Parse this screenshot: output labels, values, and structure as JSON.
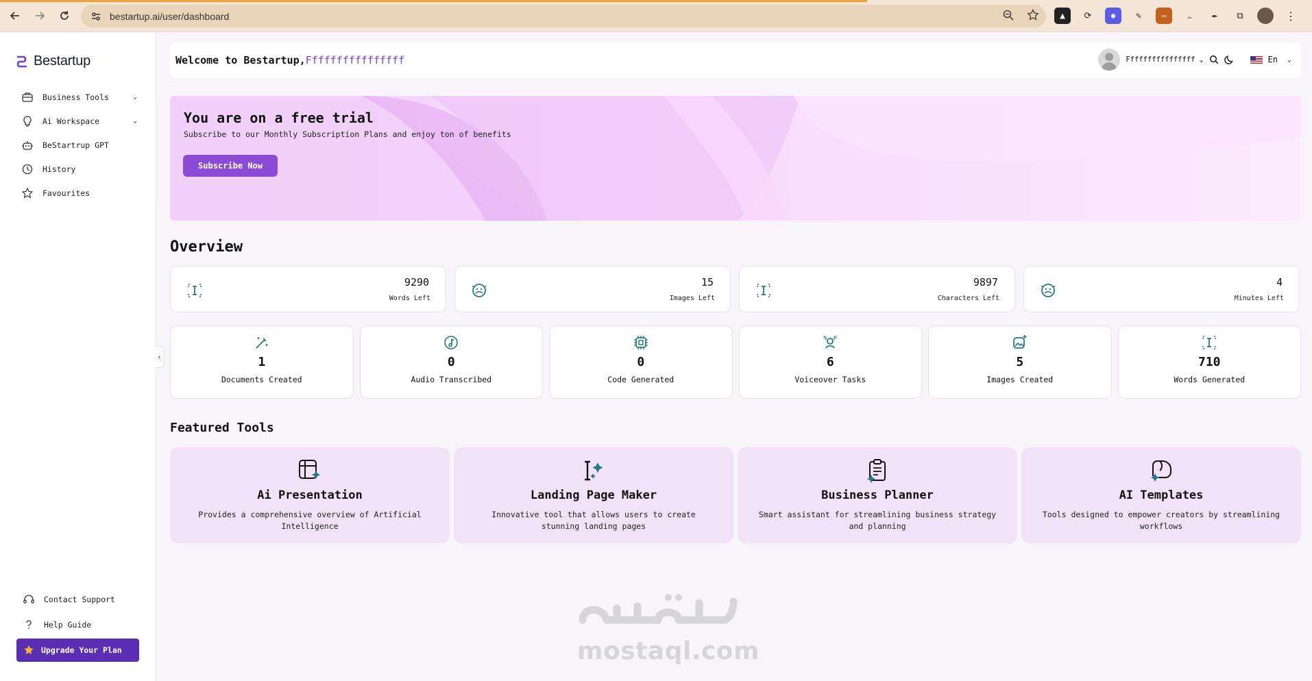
{
  "browser": {
    "url": "bestartup.ai/user/dashboard",
    "accent_load_color": "#f3a23a"
  },
  "sidebar": {
    "logo_text": "Bestartup",
    "items": [
      {
        "label": "Business Tools",
        "icon": "briefcase-icon",
        "has_chevron": true
      },
      {
        "label": "Ai Workspace",
        "icon": "lightbulb-icon",
        "has_chevron": true
      },
      {
        "label": "BeStartrup GPT",
        "icon": "robot-icon",
        "has_chevron": false
      },
      {
        "label": "History",
        "icon": "clock-icon",
        "has_chevron": false
      },
      {
        "label": "Favourites",
        "icon": "star-icon",
        "has_chevron": false
      }
    ],
    "bottom_items": [
      {
        "label": "Contact Support",
        "icon": "headset-icon"
      },
      {
        "label": "Help Guide",
        "icon": "question-icon"
      }
    ],
    "upgrade_label": "Upgrade Your Plan",
    "brand_color": "#5a2fb4"
  },
  "header": {
    "welcome_prefix": "Welcome to Bestartup,",
    "username": "Ffffffffffffffff",
    "profile_name": "Ffffffffffffffff",
    "language": "En"
  },
  "banner": {
    "title": "You are on a free trial",
    "subtitle": "Subscribe to our Monthly Subscription Plans and enjoy ton of benefits",
    "button_label": "Subscribe Now"
  },
  "overview": {
    "title": "Overview",
    "stats": [
      {
        "value": "9290",
        "label": "Words Left",
        "icon": "text-cursor-icon"
      },
      {
        "value": "15",
        "label": "Images Left",
        "icon": "image-face-icon"
      },
      {
        "value": "9897",
        "label": "Characters Left",
        "icon": "text-cursor-icon"
      },
      {
        "value": "4",
        "label": "Minutes Left",
        "icon": "image-face-icon"
      }
    ],
    "counts": [
      {
        "value": "1",
        "label": "Documents Created",
        "icon": "magic-wand-icon"
      },
      {
        "value": "0",
        "label": "Audio Transcribed",
        "icon": "music-note-icon"
      },
      {
        "value": "0",
        "label": "Code Generated",
        "icon": "chip-icon"
      },
      {
        "value": "6",
        "label": "Voiceover Tasks",
        "icon": "microphone-icon"
      },
      {
        "value": "5",
        "label": "Images Created",
        "icon": "image-sparkle-icon"
      },
      {
        "value": "710",
        "label": "Words Generated",
        "icon": "text-cursor-icon"
      }
    ]
  },
  "featured": {
    "title": "Featured Tools",
    "tools": [
      {
        "title": "Ai Presentation",
        "desc": "Provides a comprehensive overview of Artificial Intelligence",
        "icon": "presentation-icon"
      },
      {
        "title": "Landing Page Maker",
        "desc": "Innovative tool that allows users to create stunning landing pages",
        "icon": "text-sparkle-icon"
      },
      {
        "title": "Business Planner",
        "desc": "Smart assistant for streamlining business strategy and planning",
        "icon": "clipboard-icon"
      },
      {
        "title": "AI Templates",
        "desc": "Tools designed to empower creators by streamlining workflows",
        "icon": "template-icon"
      }
    ]
  },
  "watermark": {
    "arabic_text": "مستقل",
    "latin_text": "mostaql.com"
  },
  "colors": {
    "teal_icon": "#1f7a86",
    "username_purple": "#7b3fe4",
    "subscribe_purple": "#8b4bd6",
    "tool_card_bg": "#f2e2f7"
  }
}
